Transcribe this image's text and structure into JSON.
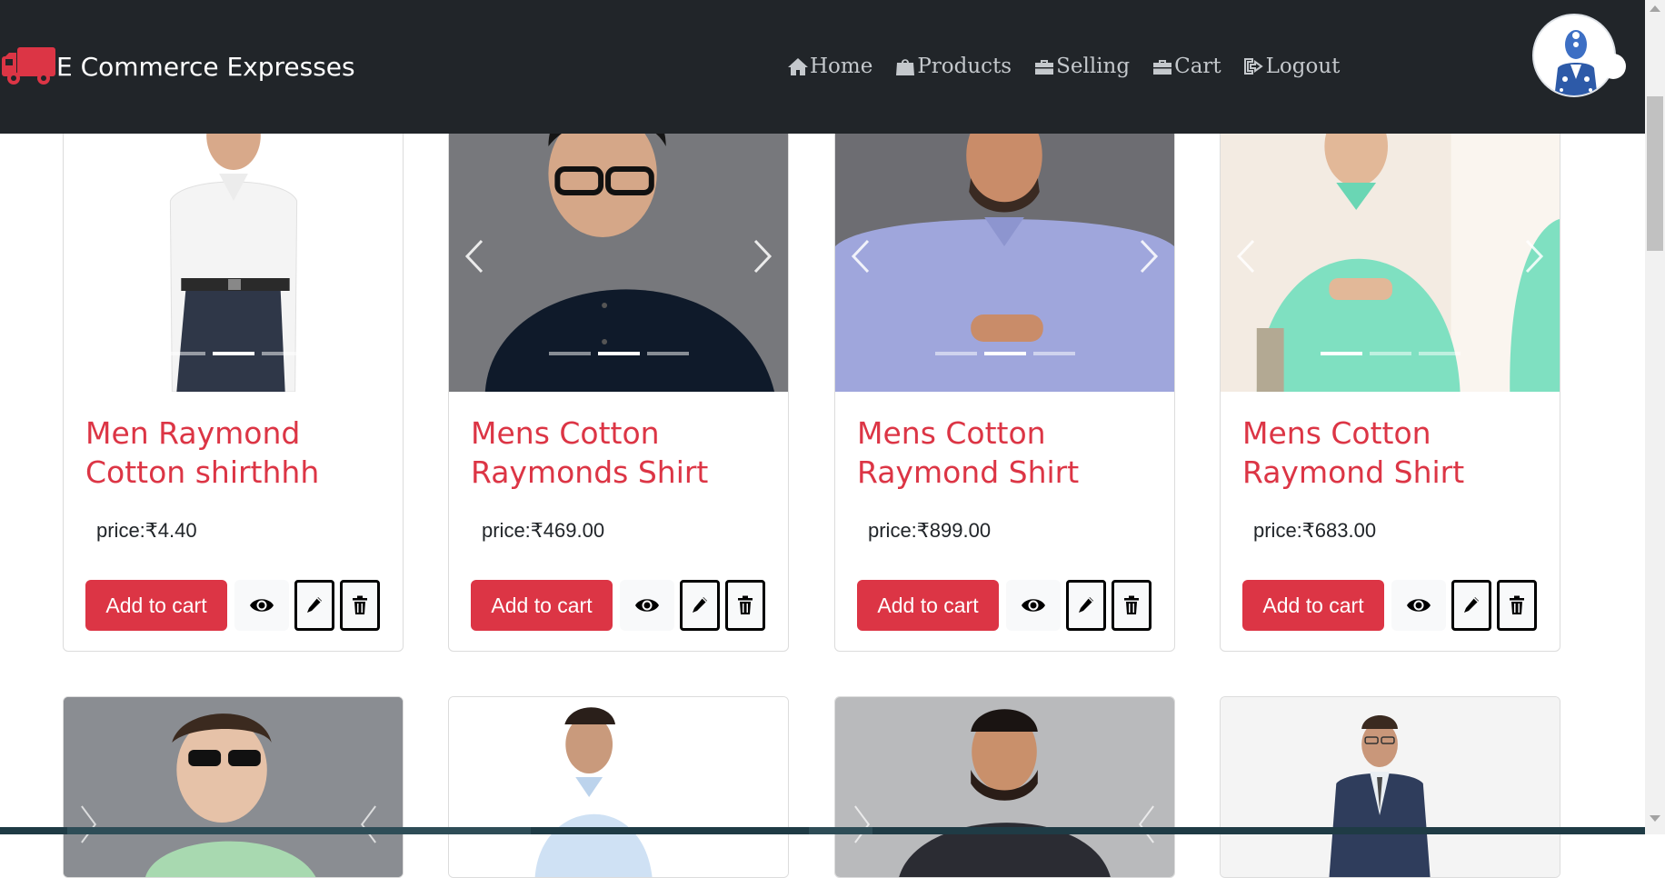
{
  "navbar": {
    "brand": "E Commerce Expresses",
    "brand_color": "#dc3545",
    "links": [
      {
        "label": "Home",
        "icon": "home-icon"
      },
      {
        "label": "Products",
        "icon": "shopping-bag-icon"
      },
      {
        "label": "Selling",
        "icon": "briefcase-icon"
      },
      {
        "label": "Cart",
        "icon": "briefcase-icon"
      },
      {
        "label": "Logout",
        "icon": "sign-out-icon"
      }
    ]
  },
  "products": [
    {
      "title": "Men Raymond Cotton shirthhh",
      "price": "price:₹4.40",
      "add_label": "Add to cart",
      "active_slide": 2,
      "has_arrows": false
    },
    {
      "title": "Mens Cotton Raymonds Shirt",
      "price": "price:₹469.00",
      "add_label": "Add to cart",
      "active_slide": 2,
      "has_arrows": true
    },
    {
      "title": "Mens Cotton Raymond Shirt",
      "price": "price:₹899.00",
      "add_label": "Add to cart",
      "active_slide": 2,
      "has_arrows": true
    },
    {
      "title": "Mens Cotton Raymond Shirt",
      "price": "price:₹683.00",
      "add_label": "Add to cart",
      "active_slide": 1,
      "has_arrows": true
    }
  ],
  "colors": {
    "navbar_bg": "#212529",
    "accent": "#dc3545",
    "nav_link": "#c4c8cc"
  }
}
